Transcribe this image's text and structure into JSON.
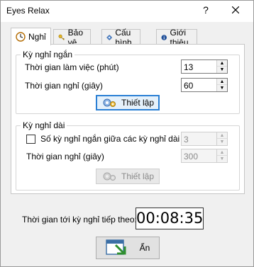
{
  "window": {
    "title": "Eyes Relax",
    "help_label": "?",
    "close_label": "X"
  },
  "tabs": [
    {
      "label": "Nghỉ",
      "icon": "clock-icon",
      "active": true
    },
    {
      "label": "Bảo vệ",
      "icon": "key-icon",
      "active": false
    },
    {
      "label": "Cấu hình",
      "icon": "gear-icon",
      "active": false
    },
    {
      "label": "Giới thiệu",
      "icon": "info-icon",
      "active": false
    }
  ],
  "short_break": {
    "legend": "Kỳ nghỉ ngắn",
    "work_time_label": "Thời gian làm việc (phút)",
    "work_time_value": "13",
    "break_time_label": "Thời gian nghỉ (giây)",
    "break_time_value": "60",
    "apply_label": "Thiết lập"
  },
  "long_break": {
    "legend": "Kỳ nghỉ dài",
    "count_label": "Số kỳ nghỉ ngắn giữa các kỳ nghỉ dài",
    "count_value": "3",
    "count_checked": false,
    "break_time_label": "Thời gian nghỉ (giây)",
    "break_time_value": "300",
    "apply_label": "Thiết lập"
  },
  "next_break": {
    "label": "Thời gian tới kỳ nghỉ tiếp theo:",
    "countdown": "00:08:35"
  },
  "hide_button": {
    "label": "Ẩn"
  },
  "colors": {
    "focus_border": "#2a7fd4",
    "panel_bg": "#ffffff",
    "window_bg": "#f0f0f0"
  }
}
